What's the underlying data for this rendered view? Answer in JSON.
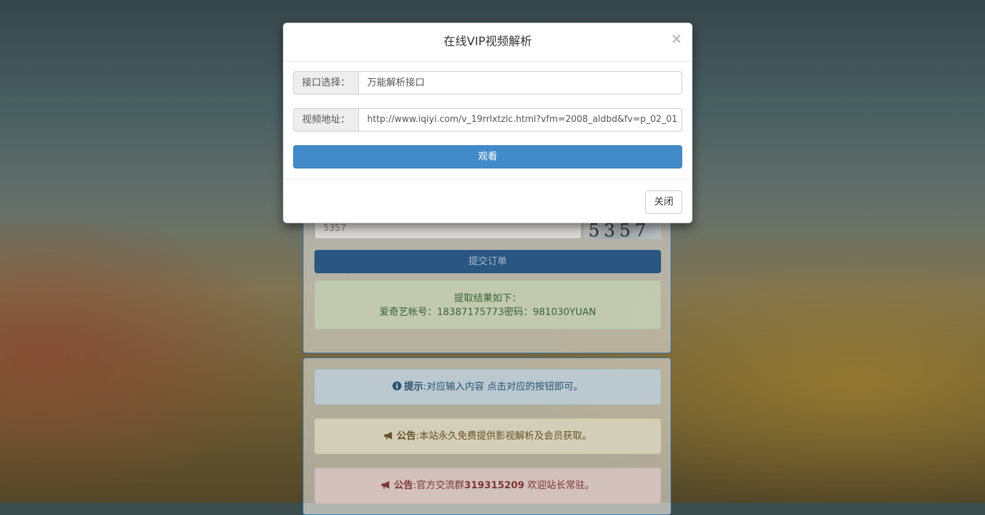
{
  "modal": {
    "title": "在线VIP视频解析",
    "close_icon": "×",
    "interface_label": "接口选择：",
    "interface_value": "万能解析接口",
    "url_label": "视频地址：",
    "url_value": "http://www.iqiyi.com/v_19rrlxtzlc.html?vfm=2008_aldbd&fv=p_02_01",
    "watch_button": "观看",
    "close_button": "关闭"
  },
  "order_panel": {
    "captcha_input_value": "5357",
    "captcha_image_text": "5357",
    "submit_button": "提交订单",
    "result_title": "提取结果如下：",
    "result_line": "爱奇艺帐号：18387175773密码：981030YUAN"
  },
  "notices": {
    "info": {
      "icon": "info-circle-icon",
      "label": "提示",
      "text": ":对应输入内容 点击对应的按钮即可。"
    },
    "notice1": {
      "icon": "bullhorn-icon",
      "label": "公告",
      "text": ":本站永久免费提供影视解析及会员获取。"
    },
    "notice2": {
      "icon": "bullhorn-icon",
      "label": "公告",
      "text_before": ":官方交流群",
      "group_number": "319315209",
      "text_after": " 欢迎站长常驻。"
    }
  },
  "colors": {
    "primary": "#428bca",
    "panel_border": "#337ab7",
    "info_text": "#2b5a7a",
    "warn_text": "#6d5a2a",
    "danger_text": "#8a3b38"
  }
}
